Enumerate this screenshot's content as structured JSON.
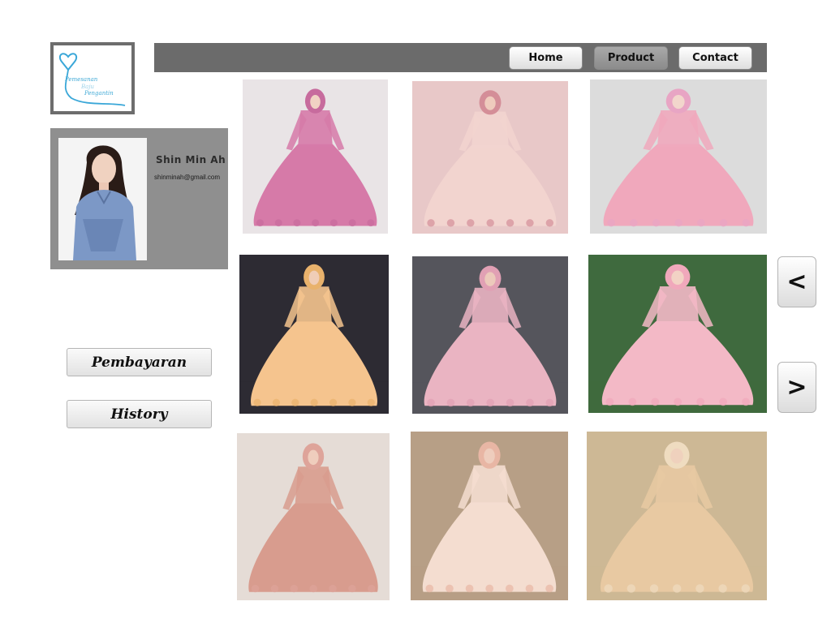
{
  "logo": {
    "line1": "Pemesanan",
    "line2": "Baju",
    "line3": "Pengantin"
  },
  "nav": {
    "items": [
      {
        "label": "Home",
        "active": false
      },
      {
        "label": "Product",
        "active": true
      },
      {
        "label": "Contact",
        "active": false
      }
    ]
  },
  "profile": {
    "name": "Shin Min Ah",
    "email": "shinminah@gmail.com"
  },
  "sidebar": {
    "payment_label": "Pembayaran",
    "history_label": "History"
  },
  "pager": {
    "prev_label": "<",
    "next_label": ">"
  },
  "products": [
    {
      "bg": "#e9e4e6",
      "dress": "#d67aa8",
      "veil": "#c76b9d",
      "skin": "#f1d3c4"
    },
    {
      "bg": "#e8c8c8",
      "dress": "#f2d4cf",
      "veil": "#d48e98",
      "skin": "#efcbbd"
    },
    {
      "bg": "#dcdcdc",
      "dress": "#f0a8bc",
      "veil": "#e8a5c4",
      "skin": "#f2d6cc"
    },
    {
      "bg": "#2d2b33",
      "dress": "#f5c48e",
      "veil": "#e9b26c",
      "skin": "#f0cdb6"
    },
    {
      "bg": "#55555c",
      "dress": "#eab4c2",
      "veil": "#e1a0b4",
      "skin": "#ecc9bb"
    },
    {
      "bg": "#3f6a3e",
      "dress": "#f3b9c6",
      "veil": "#f0a8bb",
      "skin": "#f2d2c5"
    },
    {
      "bg": "#e5dcd6",
      "dress": "#d89c8e",
      "veil": "#dea49a",
      "skin": "#efcdbd"
    },
    {
      "bg": "#b79f86",
      "dress": "#f4ddd0",
      "veil": "#e8b6a4",
      "skin": "#eecdbd"
    },
    {
      "bg": "#cdb895",
      "dress": "#e8c9a2",
      "veil": "#efdcc0",
      "skin": "#efd1bd"
    }
  ]
}
